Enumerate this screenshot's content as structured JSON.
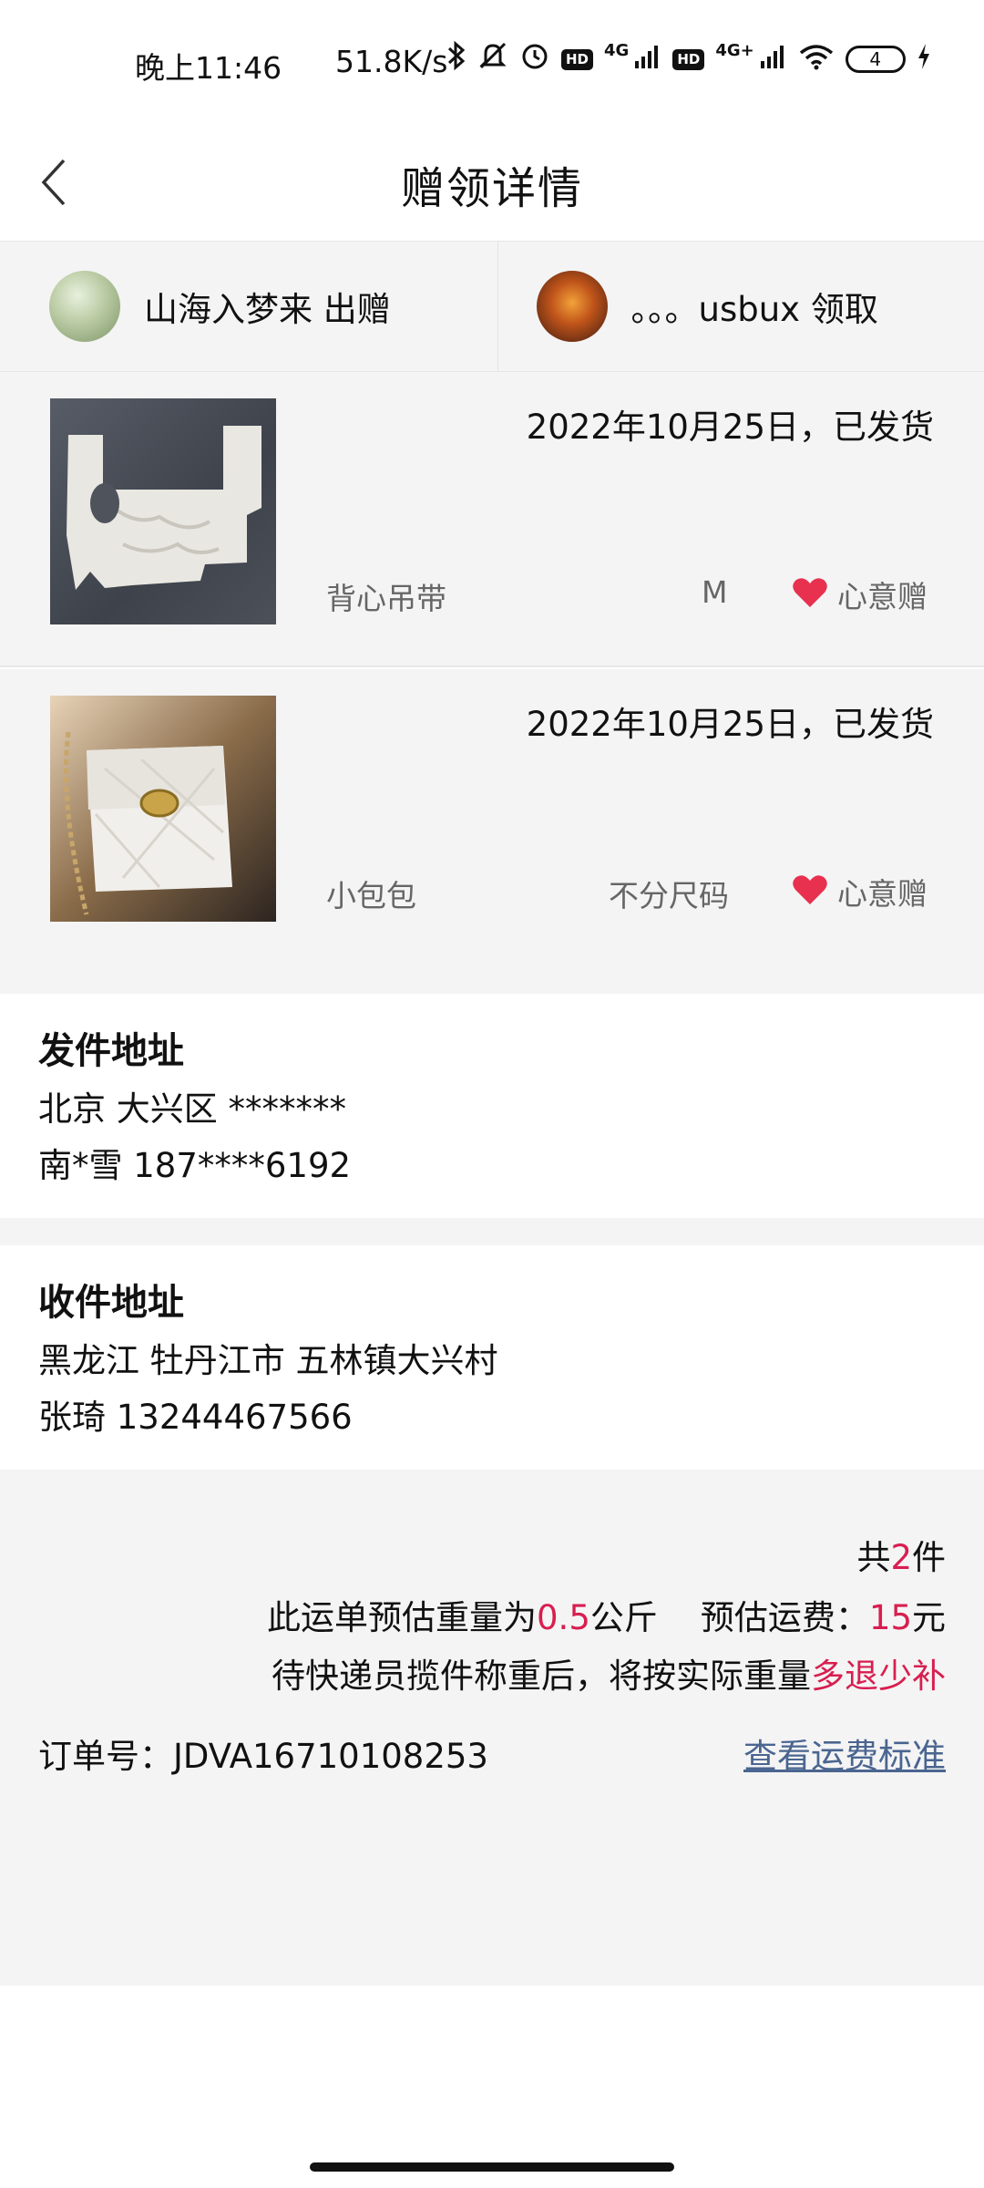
{
  "status_bar": {
    "time": "晚上11:46",
    "speed": "51.8K/s",
    "hd_badge": "HD",
    "net_4g": "4G",
    "net_4g_plus": "4G+",
    "battery": "4",
    "icons": [
      "bluetooth-icon",
      "mute-icon",
      "alarm-icon",
      "hd-icon",
      "signal-icon",
      "hd-icon",
      "signal-icon",
      "wifi-icon",
      "battery-icon",
      "charging-icon"
    ]
  },
  "nav": {
    "title": "赠领详情",
    "back_icon": "chevron-left-icon"
  },
  "parties": {
    "giver": "山海入梦来 出赠",
    "receiver": "。。。usbux 领取"
  },
  "items": [
    {
      "date_status": "2022年10月25日，已发货",
      "name": "背心吊带",
      "size": "M",
      "tag": "心意赠"
    },
    {
      "date_status": "2022年10月25日，已发货",
      "name": "小包包",
      "size": "不分尺码",
      "tag": "心意赠"
    }
  ],
  "send_address": {
    "title": "发件地址",
    "line1": "北京 大兴区 *******",
    "line2": "南*雪 187****6192"
  },
  "receive_address": {
    "title": "收件地址",
    "line1": "黑龙江 牡丹江市 五林镇大兴村",
    "line2": "张琦 13244467566"
  },
  "summary": {
    "count_prefix": "共",
    "count": "2",
    "count_suffix": "件",
    "weight_prefix": "此运单预估重量为",
    "weight": "0.5",
    "weight_unit": "公斤",
    "fee_label": "预估运费：",
    "fee": "15",
    "fee_unit": "元",
    "note_prefix": "待快递员揽件称重后，将按实际重量",
    "note_highlight": "多退少补",
    "order_no": "订单号：JDVA16710108253",
    "fee_standard_link": "查看运费标准"
  },
  "colors": {
    "accent_red": "#d81e4f",
    "link_blue": "#4a6590",
    "heart_red": "#e8304f",
    "panel_grey": "#f4f4f4"
  }
}
